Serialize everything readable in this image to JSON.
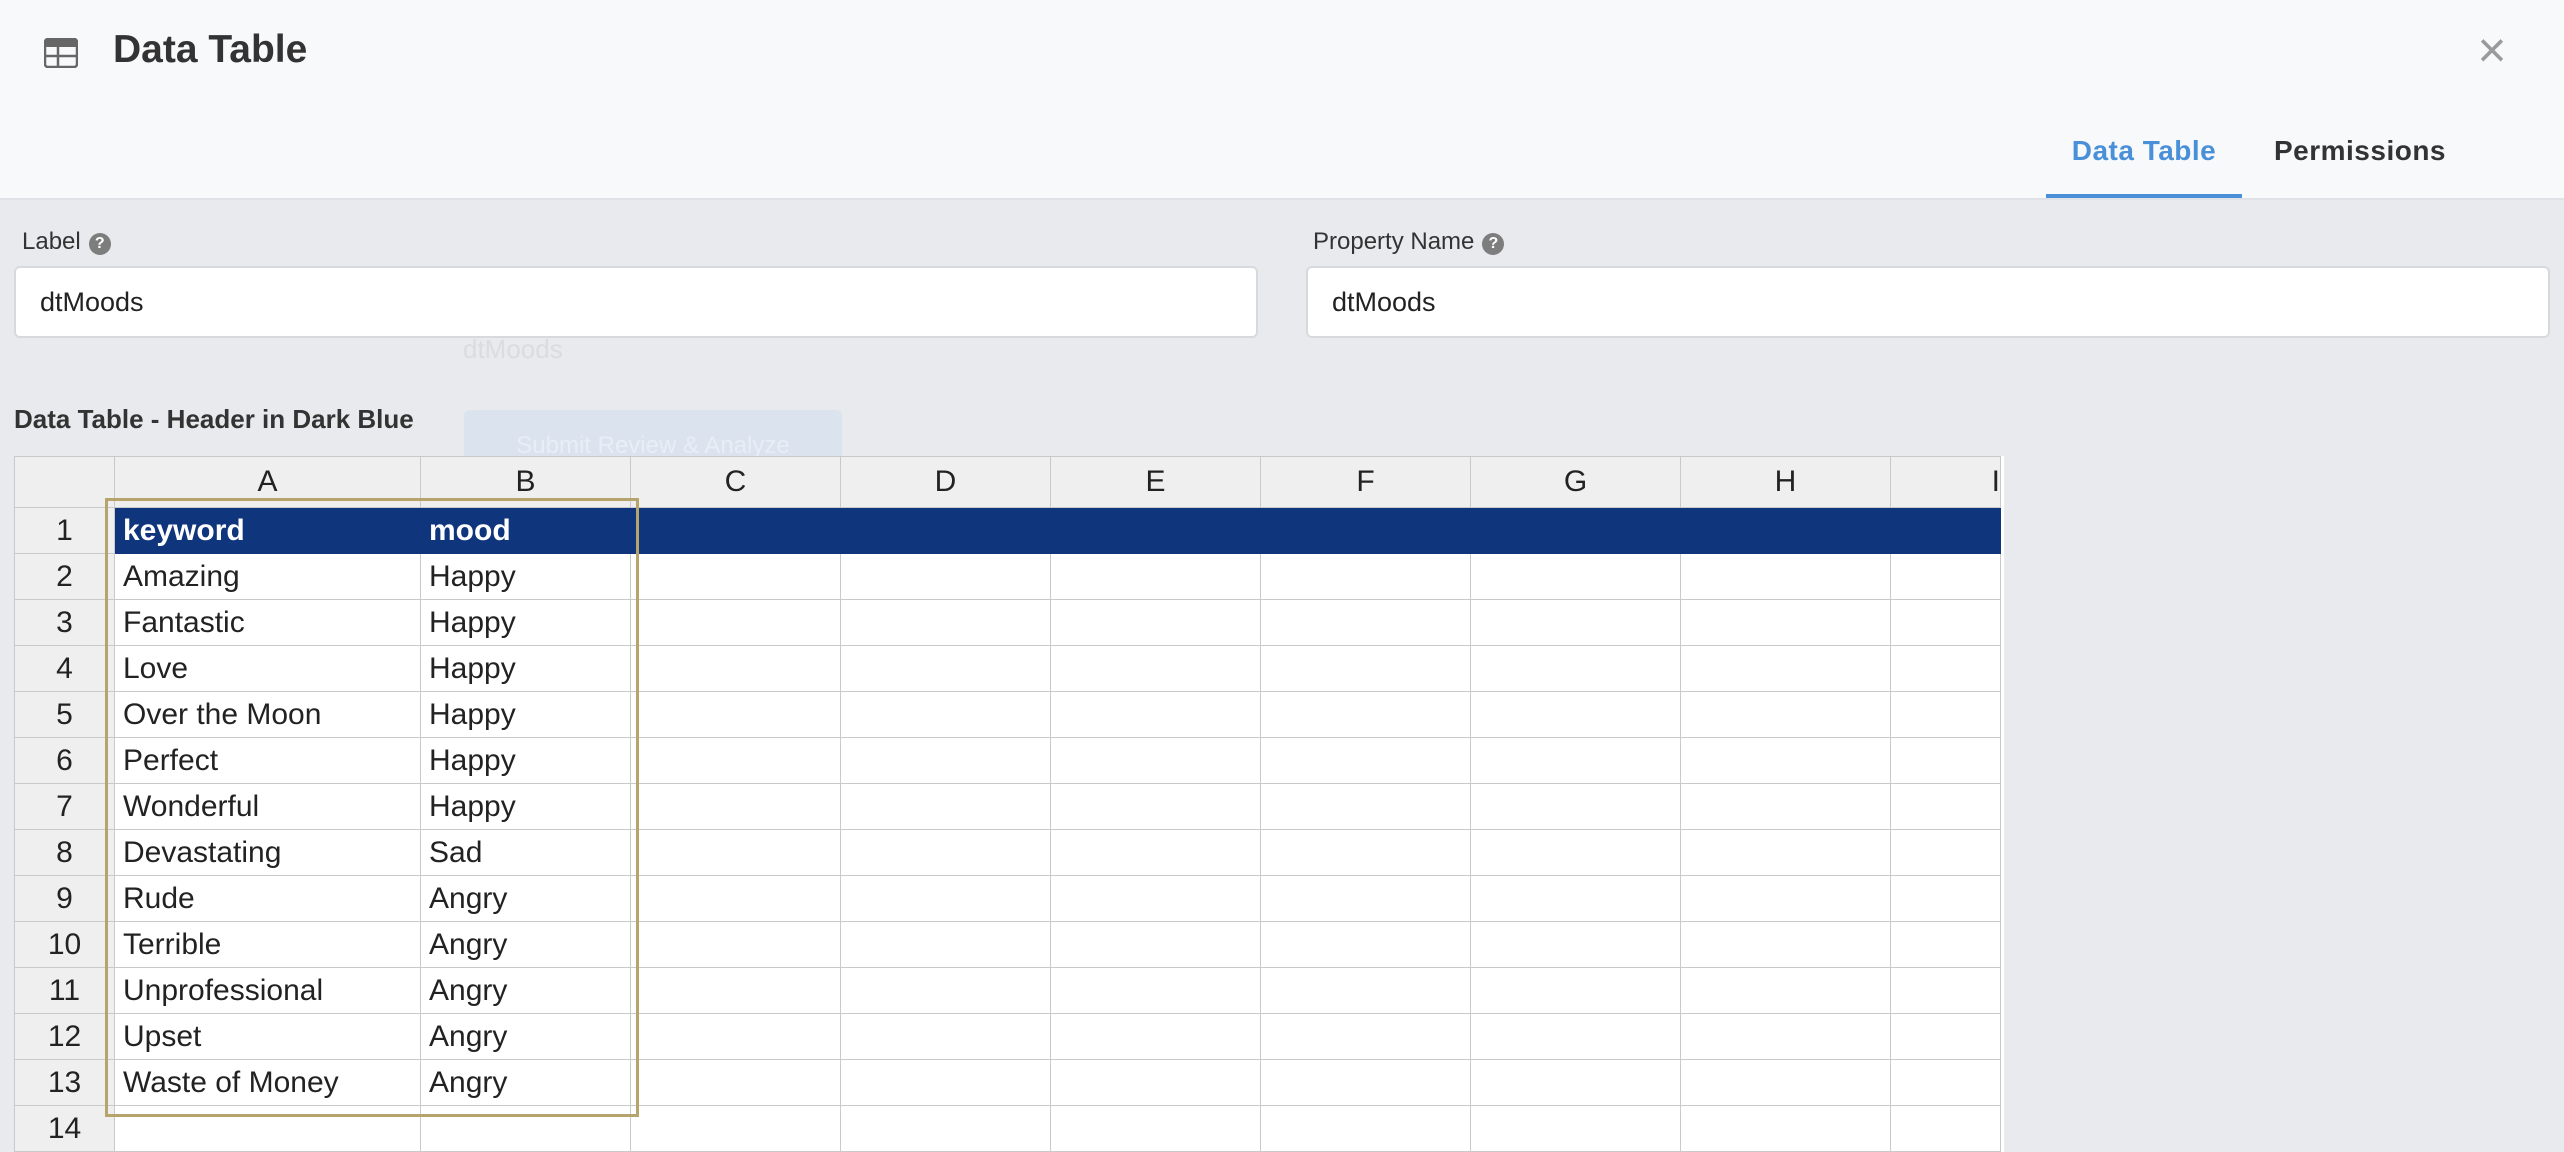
{
  "header": {
    "title": "Data Table",
    "icon": "table-icon",
    "close_symbol": "×"
  },
  "tabs": [
    {
      "label": "Data Table",
      "active": true
    },
    {
      "label": "Permissions",
      "active": false
    }
  ],
  "form": {
    "label_field": {
      "label": "Label",
      "value": "dtMoods"
    },
    "property_field": {
      "label": "Property Name",
      "value": "dtMoods"
    }
  },
  "background": {
    "ghost_text": "dtMoods",
    "ghost_button": "Submit Review & Analyze"
  },
  "section_title": "Data Table - Header in Dark Blue",
  "sheet": {
    "columns": [
      "A",
      "B",
      "C",
      "D",
      "E",
      "F",
      "G",
      "H",
      "I"
    ],
    "rows": [
      [
        "1",
        "keyword",
        "mood"
      ],
      [
        "2",
        "Amazing",
        "Happy"
      ],
      [
        "3",
        "Fantastic",
        "Happy"
      ],
      [
        "4",
        "Love",
        "Happy"
      ],
      [
        "5",
        "Over the Moon",
        "Happy"
      ],
      [
        "6",
        "Perfect",
        "Happy"
      ],
      [
        "7",
        "Wonderful",
        "Happy"
      ],
      [
        "8",
        "Devastating",
        "Sad"
      ],
      [
        "9",
        "Rude",
        "Angry"
      ],
      [
        "10",
        "Terrible",
        "Angry"
      ],
      [
        "11",
        "Unprofessional",
        "Angry"
      ],
      [
        "12",
        "Upset",
        "Angry"
      ],
      [
        "13",
        "Waste of Money",
        "Angry"
      ],
      [
        "14",
        "",
        ""
      ]
    ],
    "header_color": "#0f357c",
    "selection_color": "#b5a46c"
  },
  "colors": {
    "accent": "#4a90d9"
  }
}
